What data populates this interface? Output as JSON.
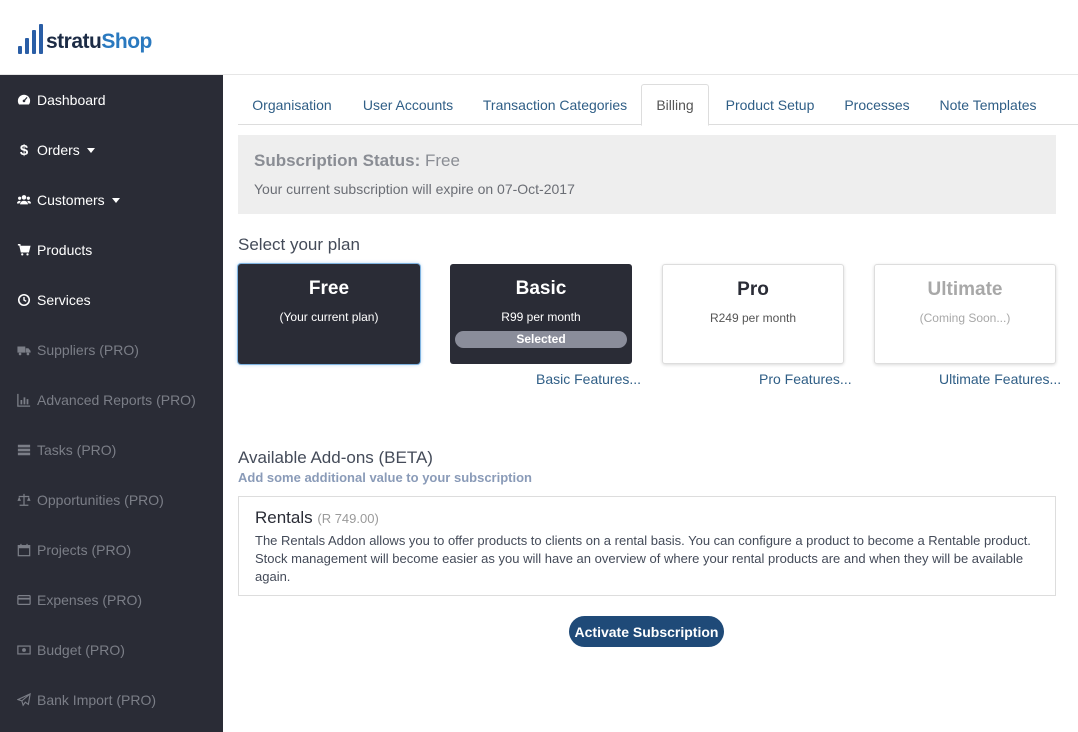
{
  "brand": {
    "name_part1": "stratu",
    "name_part2": "Shop",
    "color_dark": "#1c2b45",
    "color_accent": "#2a79bf"
  },
  "sidebar": {
    "items": [
      {
        "label": "Dashboard",
        "icon": "dashboard-icon",
        "enabled": true
      },
      {
        "label": "Orders",
        "icon": "dollar-icon",
        "enabled": true,
        "dropdown": true
      },
      {
        "label": "Customers",
        "icon": "users-icon",
        "enabled": true,
        "dropdown": true
      },
      {
        "label": "Products",
        "icon": "cart-icon",
        "enabled": true
      },
      {
        "label": "Services",
        "icon": "clock-icon",
        "enabled": true
      },
      {
        "label": "Suppliers (PRO)",
        "icon": "truck-icon",
        "enabled": false
      },
      {
        "label": "Advanced Reports (PRO)",
        "icon": "bar-chart-icon",
        "enabled": false
      },
      {
        "label": "Tasks (PRO)",
        "icon": "tasks-icon",
        "enabled": false
      },
      {
        "label": "Opportunities (PRO)",
        "icon": "balance-scale-icon",
        "enabled": false
      },
      {
        "label": "Projects (PRO)",
        "icon": "calendar-icon",
        "enabled": false
      },
      {
        "label": "Expenses (PRO)",
        "icon": "credit-card-icon",
        "enabled": false
      },
      {
        "label": "Budget (PRO)",
        "icon": "money-icon",
        "enabled": false
      },
      {
        "label": "Bank Import (PRO)",
        "icon": "paper-plane-icon",
        "enabled": false
      }
    ]
  },
  "tabs": [
    {
      "label": "Organisation",
      "active": false
    },
    {
      "label": "User Accounts",
      "active": false
    },
    {
      "label": "Transaction Categories",
      "active": false
    },
    {
      "label": "Billing",
      "active": true
    },
    {
      "label": "Product Setup",
      "active": false
    },
    {
      "label": "Processes",
      "active": false
    },
    {
      "label": "Note Templates",
      "active": false
    }
  ],
  "subscription": {
    "title_label": "Subscription Status:",
    "title_value": "Free",
    "expiry_text": "Your current subscription will expire on 07-Oct-2017"
  },
  "plans_heading": "Select your plan",
  "plans": [
    {
      "name": "Free",
      "subtitle": "(Your current plan)",
      "badge": "",
      "feature_link": ""
    },
    {
      "name": "Basic",
      "subtitle": "R99 per month",
      "badge": "Selected",
      "feature_link": "Basic Features..."
    },
    {
      "name": "Pro",
      "subtitle": "R249 per month",
      "badge": "",
      "feature_link": "Pro Features..."
    },
    {
      "name": "Ultimate",
      "subtitle": "(Coming Soon...)",
      "badge": "",
      "feature_link": "Ultimate Features..."
    }
  ],
  "addons": {
    "heading": "Available Add-ons (BETA)",
    "subheading": "Add some additional value to your subscription",
    "items": [
      {
        "title": "Rentals",
        "price": "(R 749.00)",
        "description": "The Rentals Addon allows you to offer products to clients on a rental basis. You can configure a product to become a Rentable product. Stock management will become easier as you will have an overview of where your rental products are and when they will be available again."
      }
    ]
  },
  "activate_button": "Activate Subscription",
  "colors": {
    "sidebar_bg": "#2a2c36",
    "link": "#2f5e86",
    "primary_button": "#1f4a78",
    "disabled_text": "#7b7e87"
  }
}
